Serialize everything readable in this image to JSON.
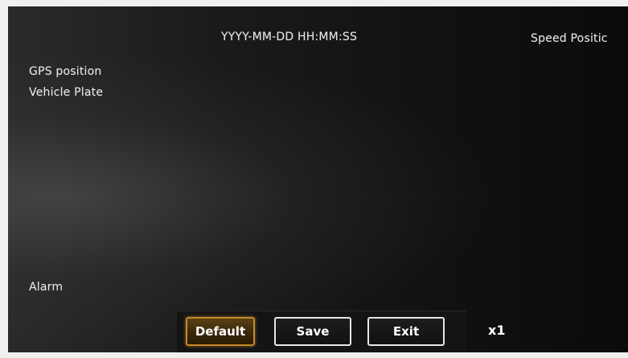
{
  "osd": {
    "timestamp": "YYYY-MM-DD HH:MM:SS",
    "speed_position": "Speed Positic",
    "gps_position": "GPS position",
    "vehicle_plate": "Vehicle Plate",
    "alarm": "Alarm"
  },
  "buttons": {
    "default_label": "Default",
    "save_label": "Save",
    "exit_label": "Exit"
  },
  "zoom": {
    "label": "x1"
  },
  "colors": {
    "screen_background": "#111111",
    "text": "#e8e8e8",
    "selected_button_border": "#c4892a",
    "button_border": "#e6e6e6"
  }
}
